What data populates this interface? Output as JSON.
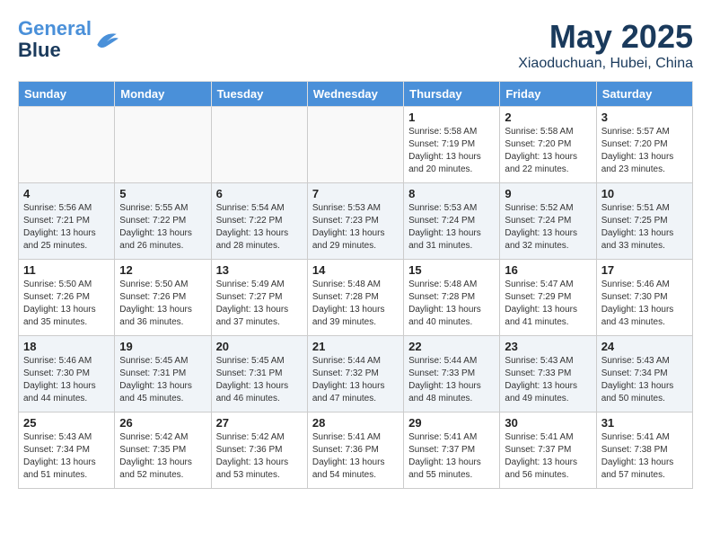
{
  "header": {
    "logo_line1": "General",
    "logo_line2": "Blue",
    "month": "May 2025",
    "location": "Xiaoduchuan, Hubei, China"
  },
  "weekdays": [
    "Sunday",
    "Monday",
    "Tuesday",
    "Wednesday",
    "Thursday",
    "Friday",
    "Saturday"
  ],
  "weeks": [
    [
      {
        "day": "",
        "info": ""
      },
      {
        "day": "",
        "info": ""
      },
      {
        "day": "",
        "info": ""
      },
      {
        "day": "",
        "info": ""
      },
      {
        "day": "1",
        "info": "Sunrise: 5:58 AM\nSunset: 7:19 PM\nDaylight: 13 hours\nand 20 minutes."
      },
      {
        "day": "2",
        "info": "Sunrise: 5:58 AM\nSunset: 7:20 PM\nDaylight: 13 hours\nand 22 minutes."
      },
      {
        "day": "3",
        "info": "Sunrise: 5:57 AM\nSunset: 7:20 PM\nDaylight: 13 hours\nand 23 minutes."
      }
    ],
    [
      {
        "day": "4",
        "info": "Sunrise: 5:56 AM\nSunset: 7:21 PM\nDaylight: 13 hours\nand 25 minutes."
      },
      {
        "day": "5",
        "info": "Sunrise: 5:55 AM\nSunset: 7:22 PM\nDaylight: 13 hours\nand 26 minutes."
      },
      {
        "day": "6",
        "info": "Sunrise: 5:54 AM\nSunset: 7:22 PM\nDaylight: 13 hours\nand 28 minutes."
      },
      {
        "day": "7",
        "info": "Sunrise: 5:53 AM\nSunset: 7:23 PM\nDaylight: 13 hours\nand 29 minutes."
      },
      {
        "day": "8",
        "info": "Sunrise: 5:53 AM\nSunset: 7:24 PM\nDaylight: 13 hours\nand 31 minutes."
      },
      {
        "day": "9",
        "info": "Sunrise: 5:52 AM\nSunset: 7:24 PM\nDaylight: 13 hours\nand 32 minutes."
      },
      {
        "day": "10",
        "info": "Sunrise: 5:51 AM\nSunset: 7:25 PM\nDaylight: 13 hours\nand 33 minutes."
      }
    ],
    [
      {
        "day": "11",
        "info": "Sunrise: 5:50 AM\nSunset: 7:26 PM\nDaylight: 13 hours\nand 35 minutes."
      },
      {
        "day": "12",
        "info": "Sunrise: 5:50 AM\nSunset: 7:26 PM\nDaylight: 13 hours\nand 36 minutes."
      },
      {
        "day": "13",
        "info": "Sunrise: 5:49 AM\nSunset: 7:27 PM\nDaylight: 13 hours\nand 37 minutes."
      },
      {
        "day": "14",
        "info": "Sunrise: 5:48 AM\nSunset: 7:28 PM\nDaylight: 13 hours\nand 39 minutes."
      },
      {
        "day": "15",
        "info": "Sunrise: 5:48 AM\nSunset: 7:28 PM\nDaylight: 13 hours\nand 40 minutes."
      },
      {
        "day": "16",
        "info": "Sunrise: 5:47 AM\nSunset: 7:29 PM\nDaylight: 13 hours\nand 41 minutes."
      },
      {
        "day": "17",
        "info": "Sunrise: 5:46 AM\nSunset: 7:30 PM\nDaylight: 13 hours\nand 43 minutes."
      }
    ],
    [
      {
        "day": "18",
        "info": "Sunrise: 5:46 AM\nSunset: 7:30 PM\nDaylight: 13 hours\nand 44 minutes."
      },
      {
        "day": "19",
        "info": "Sunrise: 5:45 AM\nSunset: 7:31 PM\nDaylight: 13 hours\nand 45 minutes."
      },
      {
        "day": "20",
        "info": "Sunrise: 5:45 AM\nSunset: 7:31 PM\nDaylight: 13 hours\nand 46 minutes."
      },
      {
        "day": "21",
        "info": "Sunrise: 5:44 AM\nSunset: 7:32 PM\nDaylight: 13 hours\nand 47 minutes."
      },
      {
        "day": "22",
        "info": "Sunrise: 5:44 AM\nSunset: 7:33 PM\nDaylight: 13 hours\nand 48 minutes."
      },
      {
        "day": "23",
        "info": "Sunrise: 5:43 AM\nSunset: 7:33 PM\nDaylight: 13 hours\nand 49 minutes."
      },
      {
        "day": "24",
        "info": "Sunrise: 5:43 AM\nSunset: 7:34 PM\nDaylight: 13 hours\nand 50 minutes."
      }
    ],
    [
      {
        "day": "25",
        "info": "Sunrise: 5:43 AM\nSunset: 7:34 PM\nDaylight: 13 hours\nand 51 minutes."
      },
      {
        "day": "26",
        "info": "Sunrise: 5:42 AM\nSunset: 7:35 PM\nDaylight: 13 hours\nand 52 minutes."
      },
      {
        "day": "27",
        "info": "Sunrise: 5:42 AM\nSunset: 7:36 PM\nDaylight: 13 hours\nand 53 minutes."
      },
      {
        "day": "28",
        "info": "Sunrise: 5:41 AM\nSunset: 7:36 PM\nDaylight: 13 hours\nand 54 minutes."
      },
      {
        "day": "29",
        "info": "Sunrise: 5:41 AM\nSunset: 7:37 PM\nDaylight: 13 hours\nand 55 minutes."
      },
      {
        "day": "30",
        "info": "Sunrise: 5:41 AM\nSunset: 7:37 PM\nDaylight: 13 hours\nand 56 minutes."
      },
      {
        "day": "31",
        "info": "Sunrise: 5:41 AM\nSunset: 7:38 PM\nDaylight: 13 hours\nand 57 minutes."
      }
    ]
  ]
}
